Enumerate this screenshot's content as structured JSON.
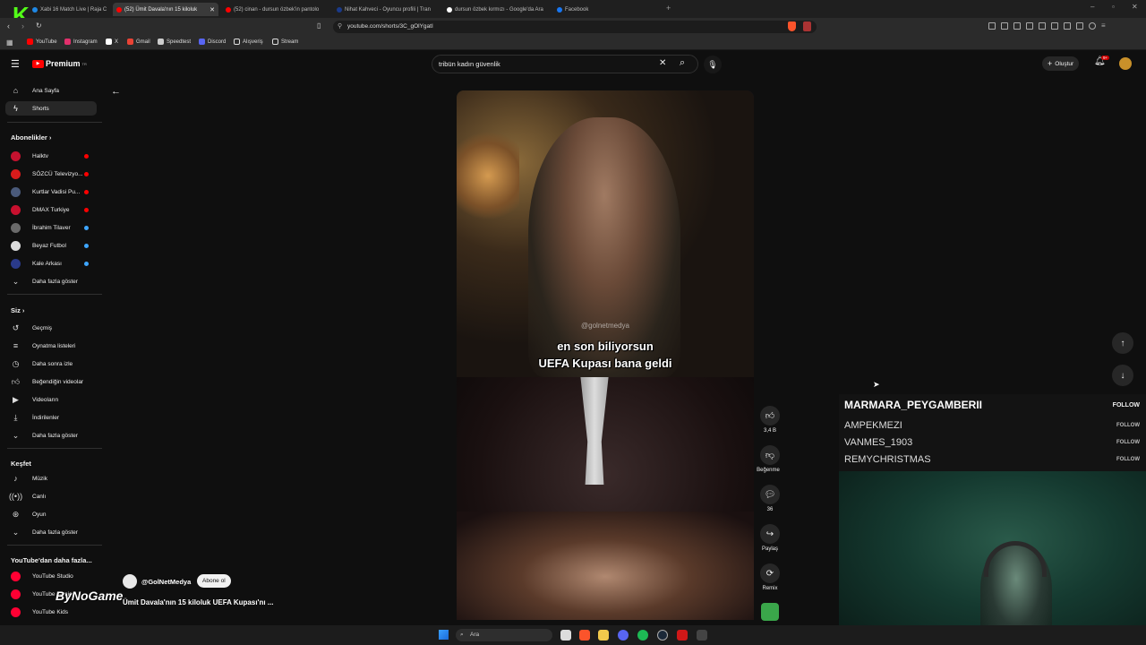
{
  "browser": {
    "tabs": [
      {
        "label": "Xabi 16 Match Live | Raja C",
        "color": "#1f88e5"
      },
      {
        "label": "(52) Ümit Davala'nın 15 kiloluk",
        "color": "#ff0000"
      },
      {
        "label": "(52) cinan - dursun özbek'in pantolo",
        "color": "#ff0000"
      },
      {
        "label": "Nihat Kahveci - Oyuncu profili | Tran",
        "color": "#1a3a8a"
      },
      {
        "label": "dursun özbek kırmızı - Google'da Ara",
        "color": "#ffffff"
      },
      {
        "label": "Facebook",
        "color": "#1877f2"
      }
    ],
    "url": "youtube.com/shorts/3C_gOlYgatI",
    "bookmarks": [
      {
        "label": "YouTube",
        "color": "#ff0000"
      },
      {
        "label": "Instagram",
        "color": "#e1306c"
      },
      {
        "label": "X",
        "color": "#ffffff"
      },
      {
        "label": "Gmail",
        "color": "#ea4335"
      },
      {
        "label": "Speedtest",
        "color": "#cccccc"
      },
      {
        "label": "Discord",
        "color": "#5865f2"
      },
      {
        "label": "Alışveriş",
        "color": "#dddddd"
      },
      {
        "label": "Stream",
        "color": "#dddddd"
      }
    ]
  },
  "youtube": {
    "logo": "Premium",
    "logo_suffix": "TR",
    "search_value": "tribün kadın güvenlik",
    "create_label": "Oluştur",
    "notif_count": "9+"
  },
  "sidebar": {
    "main": [
      {
        "label": "Ana Sayfa",
        "icon": "home-icon"
      },
      {
        "label": "Shorts",
        "icon": "shorts-icon"
      }
    ],
    "subs_title": "Abonelikler",
    "subs": [
      {
        "label": "Halktv",
        "color": "#c4122f",
        "dot": "#ff0000"
      },
      {
        "label": "SÖZCÜ Televizyo...",
        "color": "#d81b1b",
        "dot": "#ff0000"
      },
      {
        "label": "Kurtlar Vadisi Pu...",
        "color": "#4a5a7a",
        "dot": "#ff0000"
      },
      {
        "label": "DMAX Turkiye",
        "color": "#c8102e",
        "dot": "#ff0000"
      },
      {
        "label": "İbrahim Tilaver",
        "color": "#6a6a6a",
        "dot": "#3ea6ff"
      },
      {
        "label": "Beyaz Futbol",
        "color": "#dddddd",
        "dot": "#3ea6ff"
      },
      {
        "label": "Kale Arkası",
        "color": "#2a3a8a",
        "dot": "#3ea6ff"
      }
    ],
    "subs_more": "Daha fazla göster",
    "you_title": "Siz",
    "you": [
      {
        "label": "Geçmiş",
        "icon": "history-icon"
      },
      {
        "label": "Oynatma listeleri",
        "icon": "playlist-icon"
      },
      {
        "label": "Daha sonra izle",
        "icon": "clock-icon"
      },
      {
        "label": "Beğendiğin videolar",
        "icon": "like-icon"
      },
      {
        "label": "Videoların",
        "icon": "video-icon"
      },
      {
        "label": "İndirilenler",
        "icon": "download-icon"
      },
      {
        "label": "Daha fazla göster",
        "icon": "chevron-down-icon"
      }
    ],
    "explore_title": "Keşfet",
    "explore": [
      {
        "label": "Müzik",
        "icon": "music-icon"
      },
      {
        "label": "Canlı",
        "icon": "live-icon"
      },
      {
        "label": "Oyun",
        "icon": "game-icon"
      },
      {
        "label": "Daha fazla göster",
        "icon": "chevron-down-icon"
      }
    ],
    "more_title": "YouTube'dan daha fazla...",
    "more": [
      {
        "label": "YouTube Studio"
      },
      {
        "label": "YouTube Music"
      },
      {
        "label": "YouTube Kids"
      }
    ]
  },
  "short": {
    "watermark": "@golnetmedya",
    "caption_line1": "en son biliyorsun",
    "caption_line2": "UEFA Kupası bana geldi",
    "channel": "@GolNetMedya",
    "subscribe_label": "Abone ol",
    "title": "Ümit Davala'nın 15 kiloluk UEFA Kupası'nı ...",
    "likes": "3,4 B",
    "dislike_label": "Beğenme",
    "comments": "36",
    "share_label": "Paylaş",
    "remix_label": "Remix"
  },
  "stream_overlay": {
    "brand": "ByNoGame",
    "chat": [
      {
        "user": "MARMARA_PEYGAMBERII",
        "action": "FOLLOW"
      },
      {
        "user": "AMPEKMEZI",
        "action": "FOLLOW"
      },
      {
        "user": "VANMES_1903",
        "action": "FOLLOW"
      },
      {
        "user": "REMYCHRISTMAS",
        "action": "FOLLOW"
      }
    ]
  },
  "taskbar": {
    "search_placeholder": "Ara"
  }
}
